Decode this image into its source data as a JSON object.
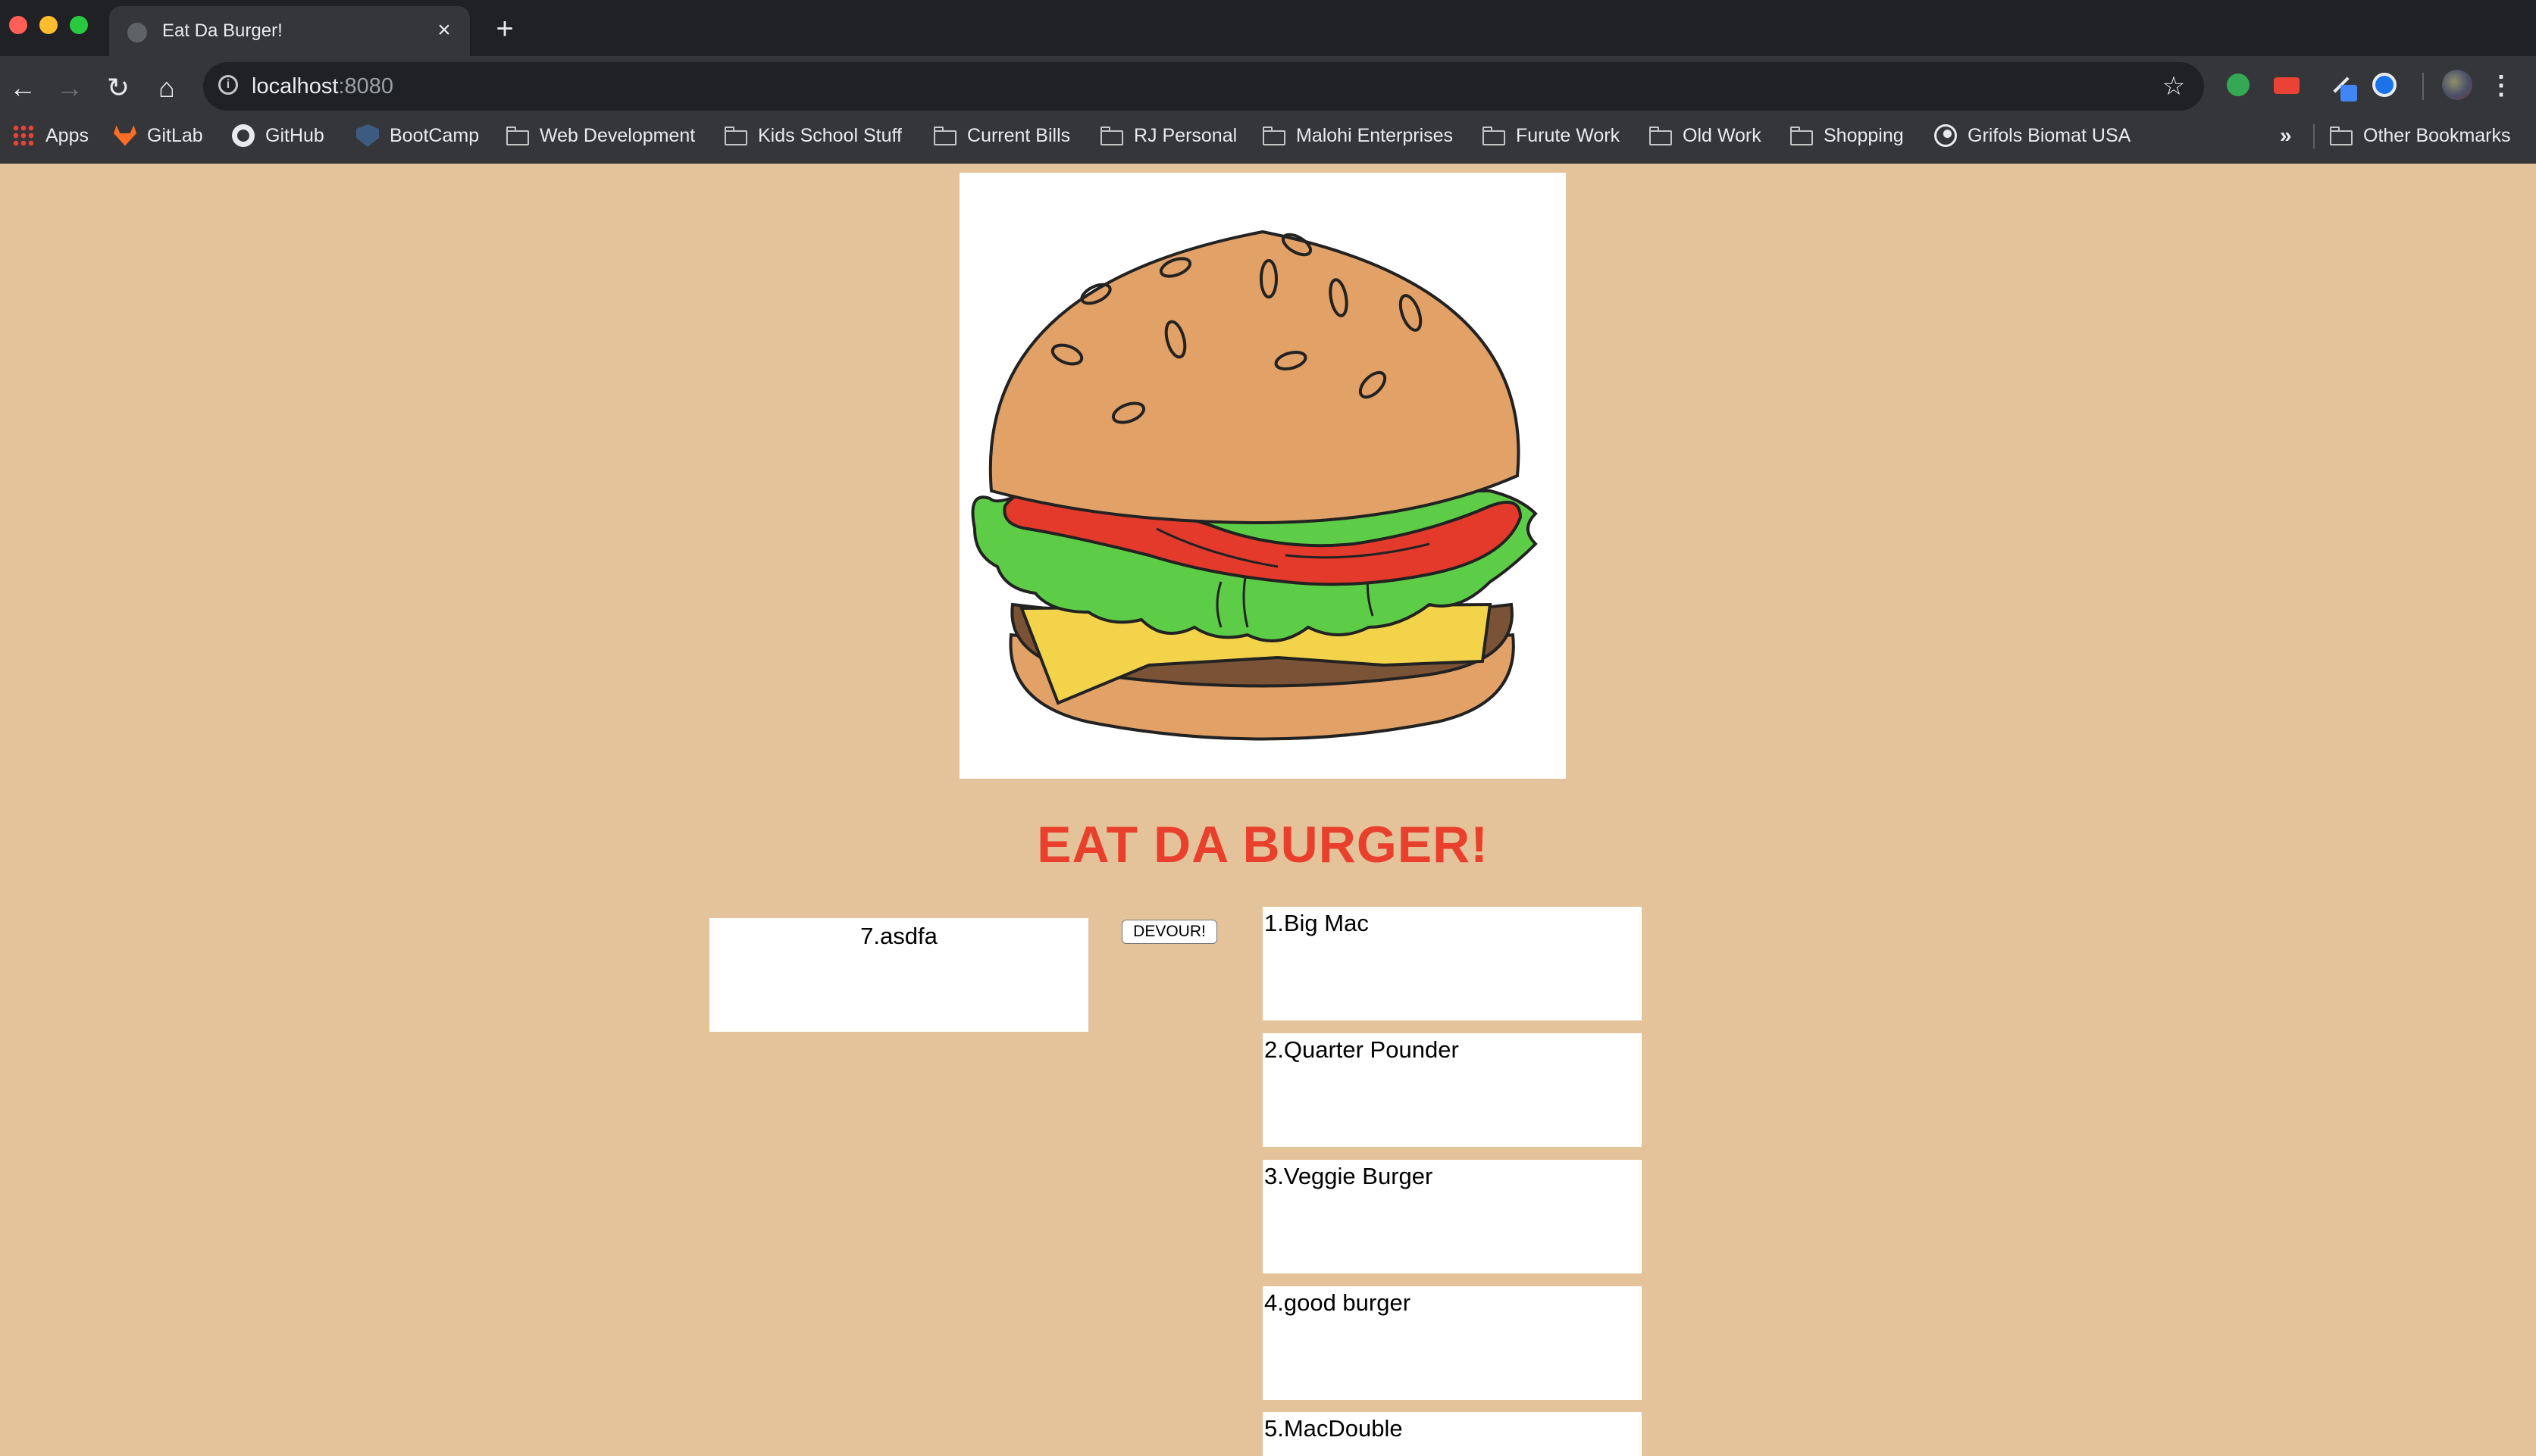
{
  "browser": {
    "tab_title": "Eat Da Burger!",
    "tab_close": "×",
    "new_tab": "+",
    "url_host": "localhost",
    "url_port": ":8080",
    "nav": {
      "back": "←",
      "forward": "→",
      "reload": "↻",
      "home": "⌂"
    },
    "star": "☆",
    "menu": "⋮",
    "info": "i",
    "bookmarks": [
      {
        "label": "Apps",
        "icon": "apps-grid-icon"
      },
      {
        "label": "GitLab",
        "icon": "gitlab-icon"
      },
      {
        "label": "GitHub",
        "icon": "github-icon"
      },
      {
        "label": "BootCamp",
        "icon": "bootcamp-icon"
      },
      {
        "label": "Web Development",
        "icon": "folder-icon"
      },
      {
        "label": "Kids School Stuff",
        "icon": "folder-icon"
      },
      {
        "label": "Current Bills",
        "icon": "folder-icon"
      },
      {
        "label": "RJ Personal",
        "icon": "folder-icon"
      },
      {
        "label": "Malohi Enterprises",
        "icon": "folder-icon"
      },
      {
        "label": "Furute Work",
        "icon": "folder-icon"
      },
      {
        "label": "Old Work",
        "icon": "folder-icon"
      },
      {
        "label": "Shopping",
        "icon": "folder-icon"
      },
      {
        "label": "Grifols Biomat USA",
        "icon": "globe-icon"
      }
    ],
    "bookmarks_overflow": "»",
    "other_bookmarks": "Other Bookmarks"
  },
  "page": {
    "title": "EAT DA BURGER!",
    "hero_image": "burger-illustration",
    "devour_label": "DEVOUR!",
    "undevoured": [
      {
        "label": "7.asdfa"
      }
    ],
    "devoured": [
      {
        "label": "1.Big Mac"
      },
      {
        "label": "2.Quarter Pounder"
      },
      {
        "label": "3.Veggie Burger"
      },
      {
        "label": "4.good burger"
      },
      {
        "label": "5.MacDouble"
      }
    ]
  },
  "colors": {
    "page_background": "#e5c39a",
    "title_red": "#e8402c",
    "chrome_dark": "#202124",
    "chrome_toolbar": "#35363a"
  }
}
